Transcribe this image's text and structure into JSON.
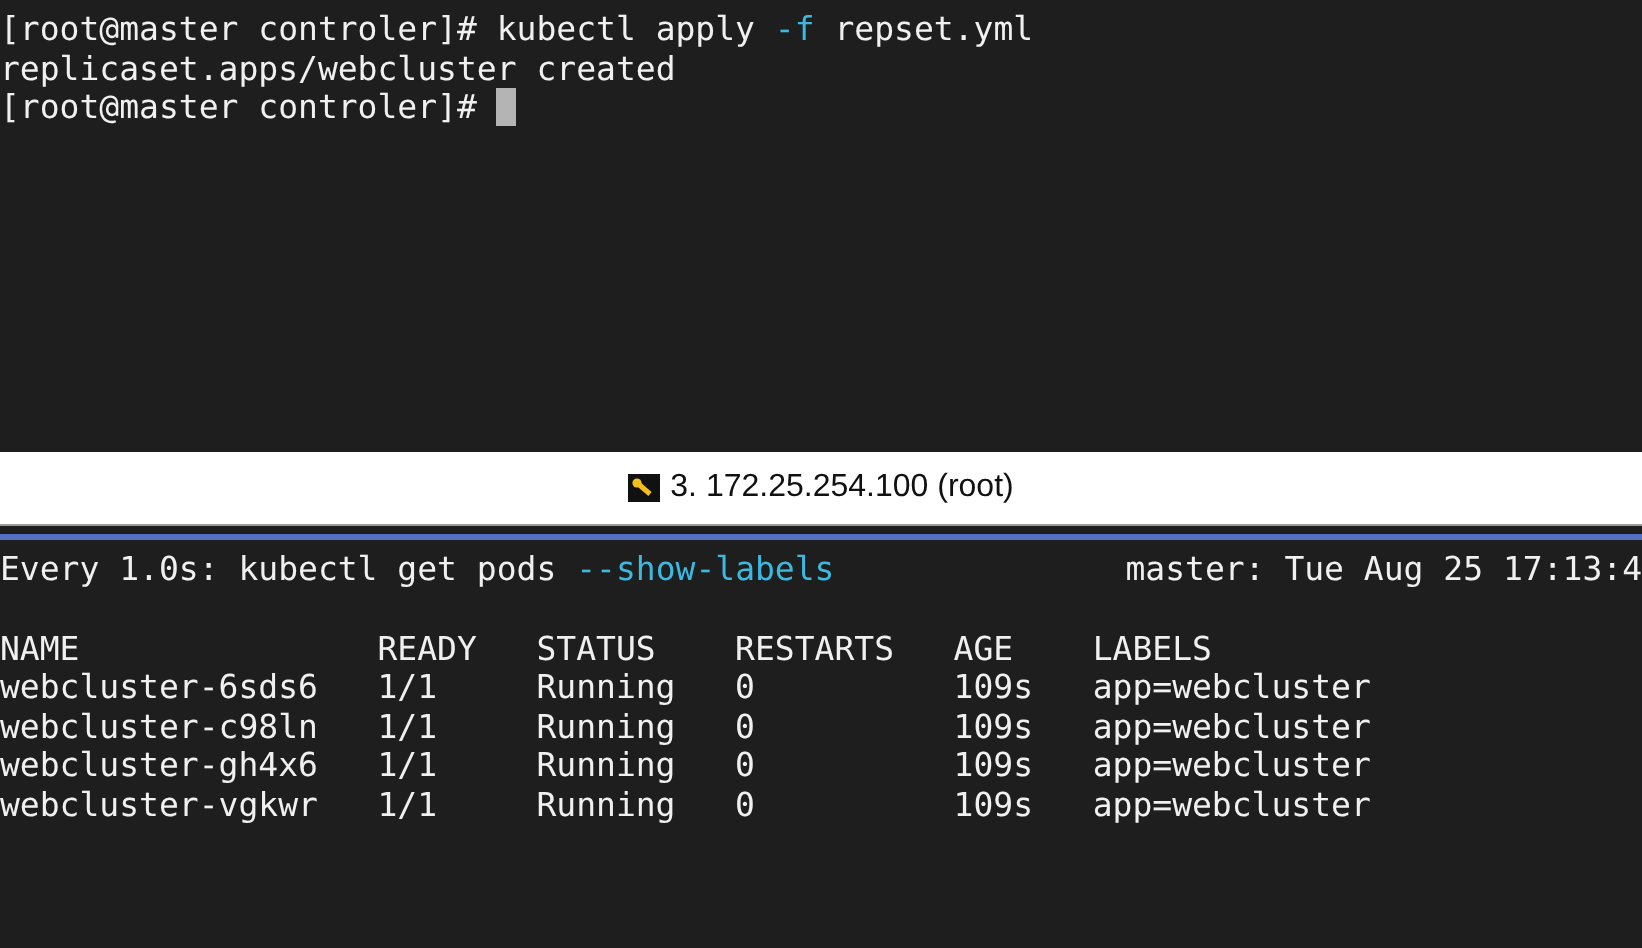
{
  "top_pane": {
    "lines": [
      {
        "segments": [
          {
            "text": "[root@master controler]# kubectl apply ",
            "kind": "plain"
          },
          {
            "text": "-f",
            "kind": "flag"
          },
          {
            "text": " repset.yml",
            "kind": "plain"
          }
        ]
      },
      {
        "segments": [
          {
            "text": "replicaset.apps/webcluster created",
            "kind": "plain"
          }
        ]
      },
      {
        "segments": [
          {
            "text": "[root@master controler]# ",
            "kind": "plain"
          }
        ],
        "cursor": true
      }
    ]
  },
  "session_tab": {
    "title": "3. 172.25.254.100 (root)"
  },
  "bottom_pane": {
    "watch_header": {
      "segments": [
        {
          "text": "Every 1.0s: kubectl get pods ",
          "kind": "plain"
        },
        {
          "text": "--show-labels",
          "kind": "flag"
        }
      ],
      "status": "master: Tue Aug 25 17:13:4"
    },
    "table": {
      "columns": [
        "NAME",
        "READY",
        "STATUS",
        "RESTARTS",
        "AGE",
        "LABELS"
      ],
      "rows": [
        [
          "webcluster-6sds6",
          "1/1",
          "Running",
          "0",
          "109s",
          "app=webcluster"
        ],
        [
          "webcluster-c98ln",
          "1/1",
          "Running",
          "0",
          "109s",
          "app=webcluster"
        ],
        [
          "webcluster-gh4x6",
          "1/1",
          "Running",
          "0",
          "109s",
          "app=webcluster"
        ],
        [
          "webcluster-vgkwr",
          "1/1",
          "Running",
          "0",
          "109s",
          "app=webcluster"
        ]
      ]
    }
  }
}
